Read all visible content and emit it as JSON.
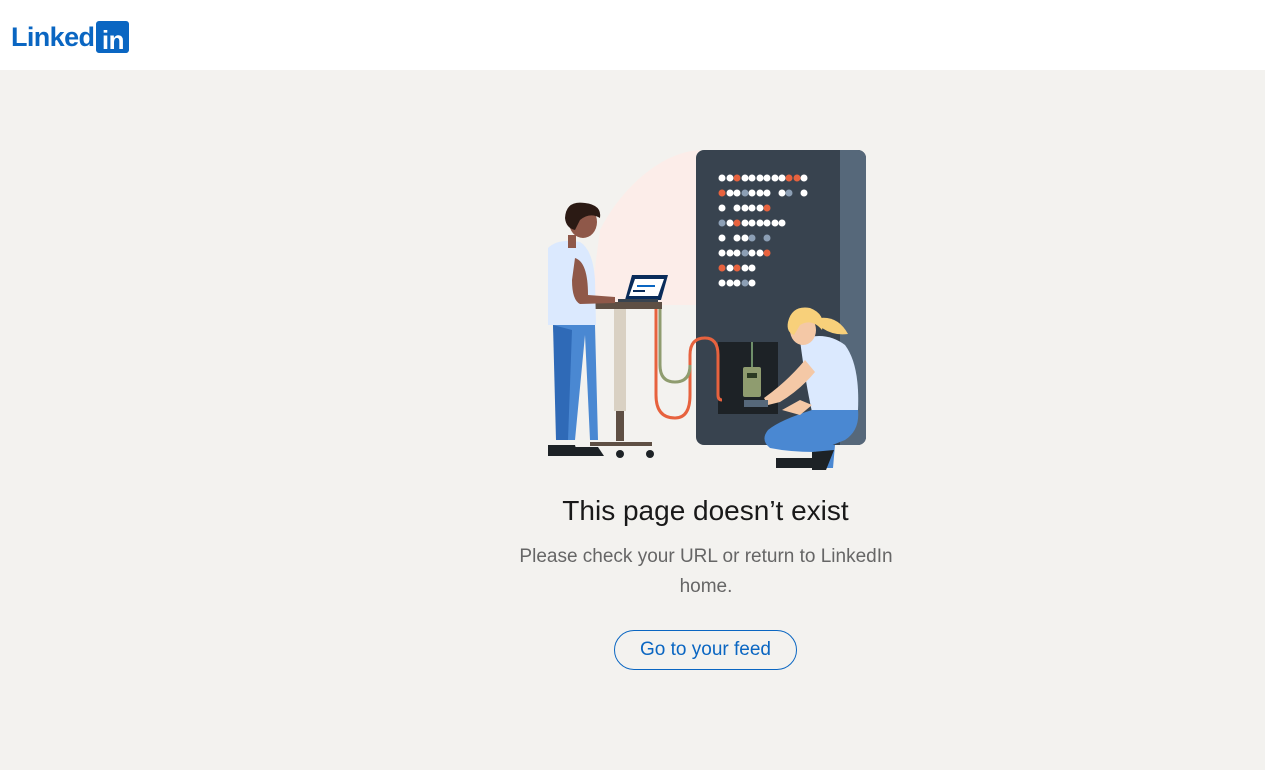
{
  "header": {
    "logo_word": "Linked",
    "logo_box": "in"
  },
  "main": {
    "illustration_icon": "server-repair-illustration",
    "title": "This page doesn’t exist",
    "message": "Please check your URL or return to LinkedIn home.",
    "feed_button_label": "Go to your feed"
  },
  "colors": {
    "brand_blue": "#0a66c2",
    "page_bg": "#f3f2ef",
    "header_bg": "#ffffff",
    "title_text": "#191919",
    "message_text": "#666666"
  }
}
